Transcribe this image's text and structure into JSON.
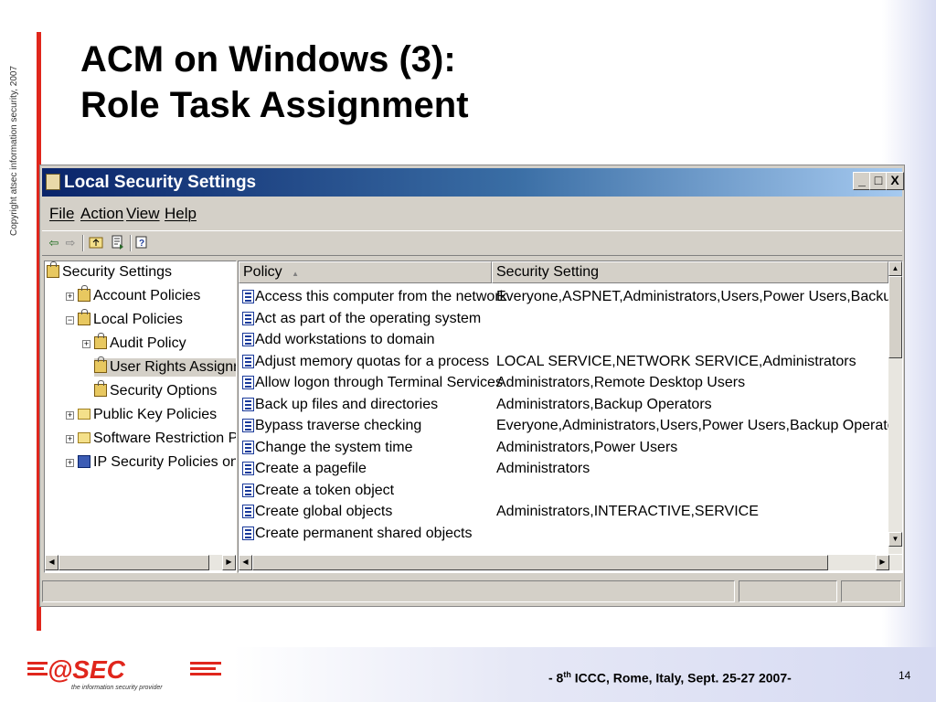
{
  "slide": {
    "title_line1": "ACM on Windows (3):",
    "title_line2": "Role Task Assignment",
    "copyright": "Copyright atsec information security, 2007",
    "footer_prefix": "- 8",
    "footer_sup": "th",
    "footer_suffix": " ICCC, Rome, Italy, Sept. 25-27 2007-",
    "page_number": "14",
    "logo_text": "=@SEC=",
    "logo_tagline": "the information security provider",
    "accent_color": "#e0261c"
  },
  "window": {
    "title": "Local Security Settings",
    "controls": {
      "minimize": "_",
      "maximize": "□",
      "close": "X"
    },
    "menu": [
      "File",
      "Action",
      "View",
      "Help"
    ],
    "toolbar_icons": [
      "back-icon",
      "forward-icon",
      "up-folder-icon",
      "export-list-icon",
      "help-icon"
    ]
  },
  "tree": [
    {
      "label": "Security Settings",
      "level": 0,
      "expander": "",
      "icon": "security-settings-icon"
    },
    {
      "label": "Account Policies",
      "level": 1,
      "expander": "+",
      "icon": "folder-lock-icon"
    },
    {
      "label": "Local Policies",
      "level": 1,
      "expander": "-",
      "icon": "folder-lock-icon"
    },
    {
      "label": "Audit Policy",
      "level": 2,
      "expander": "+",
      "icon": "folder-lock-icon"
    },
    {
      "label": "User Rights Assignment",
      "level": 2,
      "expander": "",
      "icon": "folder-lock-icon",
      "selected": true
    },
    {
      "label": "Security Options",
      "level": 2,
      "expander": "",
      "icon": "folder-lock-icon"
    },
    {
      "label": "Public Key Policies",
      "level": 1,
      "expander": "+",
      "icon": "folder-icon"
    },
    {
      "label": "Software Restriction Policies",
      "level": 1,
      "expander": "+",
      "icon": "folder-icon"
    },
    {
      "label": "IP Security Policies on Local C",
      "level": 1,
      "expander": "+",
      "icon": "network-policy-icon"
    }
  ],
  "list": {
    "columns": [
      "Policy",
      "Security Setting"
    ],
    "sort_indicator": "▲",
    "rows": [
      {
        "policy": "Access this computer from the network",
        "setting": "Everyone,ASPNET,Administrators,Users,Power Users,Backup Operators"
      },
      {
        "policy": "Act as part of the operating system",
        "setting": ""
      },
      {
        "policy": "Add workstations to domain",
        "setting": ""
      },
      {
        "policy": "Adjust memory quotas for a process",
        "setting": "LOCAL SERVICE,NETWORK SERVICE,Administrators"
      },
      {
        "policy": "Allow logon through Terminal Services",
        "setting": "Administrators,Remote Desktop Users"
      },
      {
        "policy": "Back up files and directories",
        "setting": "Administrators,Backup Operators"
      },
      {
        "policy": "Bypass traverse checking",
        "setting": "Everyone,Administrators,Users,Power Users,Backup Operators"
      },
      {
        "policy": "Change the system time",
        "setting": "Administrators,Power Users"
      },
      {
        "policy": "Create a pagefile",
        "setting": "Administrators"
      },
      {
        "policy": "Create a token object",
        "setting": ""
      },
      {
        "policy": "Create global objects",
        "setting": "Administrators,INTERACTIVE,SERVICE"
      },
      {
        "policy": "Create permanent shared objects",
        "setting": ""
      }
    ]
  },
  "scroll": {
    "up": "▲",
    "down": "▼",
    "left": "◀",
    "right": "▶"
  }
}
